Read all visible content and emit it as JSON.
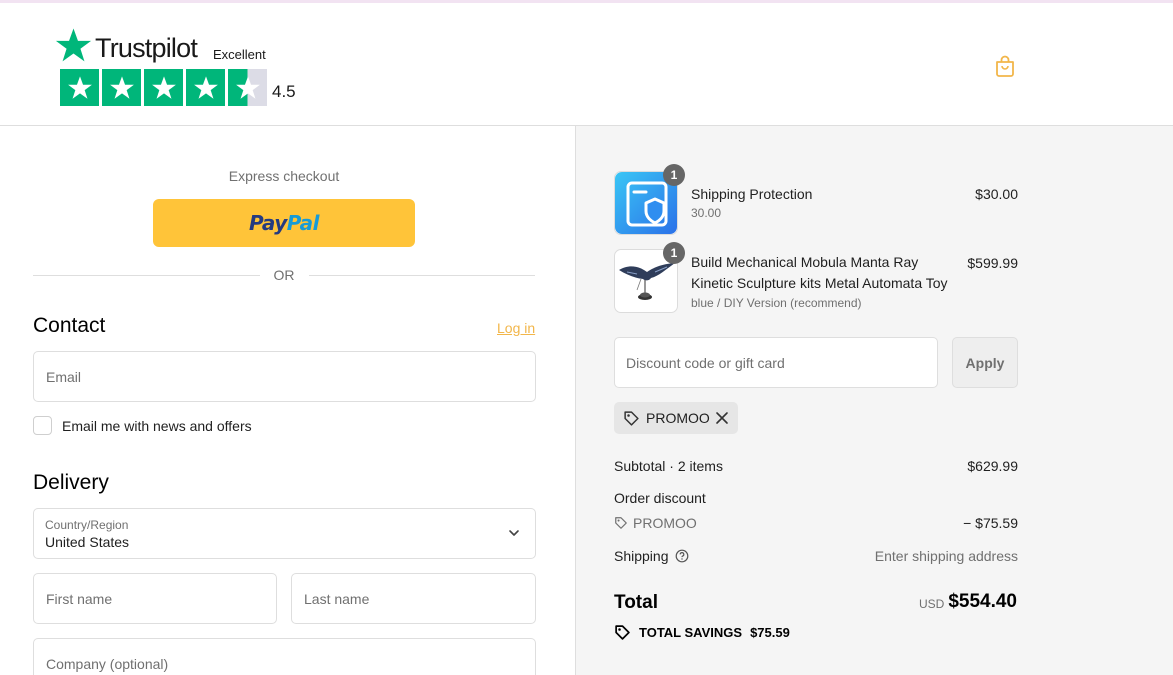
{
  "header": {
    "trustpilot_name": "Trustpilot",
    "trustpilot_rating_text": "Excellent",
    "trustpilot_score": "4.5",
    "brand_color": "#00b67a"
  },
  "express": {
    "title": "Express checkout",
    "paypal_part1": "Pay",
    "paypal_part2": "Pal",
    "or_label": "OR"
  },
  "contact": {
    "title": "Contact",
    "login_link": "Log in",
    "email_placeholder": "Email",
    "newsletter_label": "Email me with news and offers"
  },
  "delivery": {
    "title": "Delivery",
    "country_label": "Country/Region",
    "country_value": "United States",
    "first_name_placeholder": "First name",
    "last_name_placeholder": "Last name",
    "company_placeholder": "Company (optional)"
  },
  "order": {
    "items": [
      {
        "title": "Shipping Protection",
        "subtitle": "30.00",
        "price": "$30.00",
        "quantity": "1"
      },
      {
        "title_line1": "Build Mechanical Mobula Manta Ray",
        "title_line2": "Kinetic Sculpture kits Metal Automata Toy",
        "subtitle": "blue / DIY Version (recommend)",
        "price": "$599.99",
        "quantity": "1"
      }
    ],
    "discount_placeholder": "Discount code or gift card",
    "apply_label": "Apply",
    "applied_code": "PROMOO",
    "subtotal_label": "Subtotal · 2 items",
    "subtotal_value": "$629.99",
    "order_discount_label": "Order discount",
    "discount_code": "PROMOO",
    "discount_value": "− $75.59",
    "shipping_label": "Shipping",
    "shipping_value": "Enter shipping address",
    "total_label": "Total",
    "currency": "USD",
    "total_value": "$554.40",
    "savings_label": "TOTAL SAVINGS",
    "savings_value": "$75.59"
  }
}
